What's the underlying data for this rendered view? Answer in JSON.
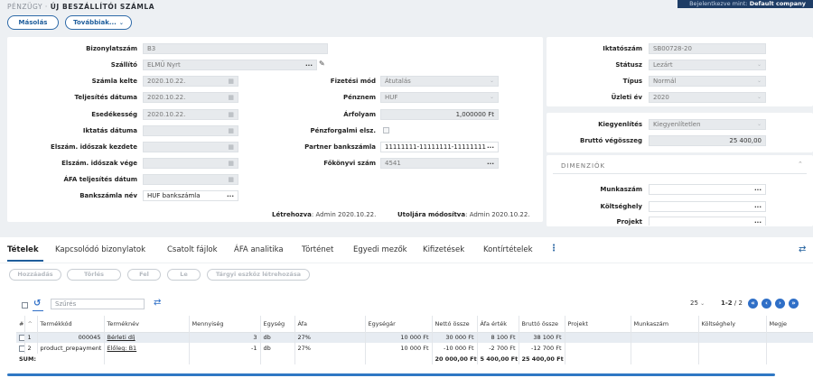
{
  "breadcrumb": {
    "section": "PÉNZÜGY",
    "separator": "·",
    "title": "ÚJ BESZÁLLÍTÓI SZÁMLA"
  },
  "login": {
    "prefix": "Bejelentkezve mint:",
    "company": "Default company"
  },
  "toolbar": {
    "copy_label": "Másolás",
    "more_label": "Továbbiak..."
  },
  "form": {
    "bizonylatszam": {
      "label": "Bizonylatszám",
      "value": "B3"
    },
    "szallito": {
      "label": "Szállító",
      "value": "ELMŰ Nyrt"
    },
    "szamla_kelte": {
      "label": "Számla kelte",
      "value": "2020.10.22."
    },
    "teljesites": {
      "label": "Teljesítés dátuma",
      "value": "2020.10.22."
    },
    "esedekesseg": {
      "label": "Esedékesség",
      "value": "2020.10.22."
    },
    "iktatas": {
      "label": "Iktatás dátuma",
      "value": ""
    },
    "elsz_kezdete": {
      "label": "Elszám. időszak kezdete",
      "value": ""
    },
    "elsz_vege": {
      "label": "Elszám. időszak vége",
      "value": ""
    },
    "afa_telj": {
      "label": "ÁFA teljesítés dátum",
      "value": ""
    },
    "bankszamla_nev": {
      "label": "Bankszámla név",
      "value": "HUF bankszámla"
    },
    "fizetesi_mod": {
      "label": "Fizetési mód",
      "value": "Átutalás"
    },
    "penznem": {
      "label": "Pénznem",
      "value": "HUF"
    },
    "arfolyam": {
      "label": "Árfolyam",
      "value": "1,000000 Ft"
    },
    "penzforgalmi": {
      "label": "Pénzforgalmi elsz."
    },
    "partner_bank": {
      "label": "Partner bankszámla",
      "value": "11111111-11111111-11111111"
    },
    "fokonyvi": {
      "label": "Főkönyvi szám",
      "value": "4541"
    },
    "created_label": "Létrehozva",
    "created_value": ": Admin 2020.10.22.",
    "modified_label": "Utoljára módosítva",
    "modified_value": ": Admin 2020.10.22."
  },
  "side": {
    "iktatoszam": {
      "label": "Iktatószám",
      "value": "SB00728-20"
    },
    "statusz": {
      "label": "Státusz",
      "value": "Lezárt"
    },
    "tipus": {
      "label": "Típus",
      "value": "Normál"
    },
    "uzleti_ev": {
      "label": "Üzleti év",
      "value": "2020"
    },
    "kiegyenlites": {
      "label": "Kiegyenlítés",
      "value": "Kiegyenlítetlen"
    },
    "brutto": {
      "label": "Bruttó végösszeg",
      "value": "25 400,00"
    },
    "dimensions_title": "DIMENZIÓK",
    "munkaszam": {
      "label": "Munkaszám"
    },
    "koltseghely": {
      "label": "Költséghely"
    },
    "projekt": {
      "label": "Projekt"
    }
  },
  "tabs": [
    "Tételek",
    "Kapcsolódó bizonylatok",
    "Csatolt fájlok",
    "ÁFA analitika",
    "Történet",
    "Egyedi mezők",
    "Kifizetések",
    "Kontírtételek"
  ],
  "actions": [
    "Hozzáadás",
    "Törlés",
    "Fel",
    "Le",
    "Tárgyi eszköz létrehozása"
  ],
  "filter": {
    "placeholder": "Szűrés"
  },
  "pager": {
    "page_size": "25",
    "range": "1-2",
    "total": "/ 2"
  },
  "table": {
    "headers": [
      "#",
      "Termékkód",
      "Terméknév",
      "Mennyiség",
      "Egység",
      "Áfa",
      "Egységár",
      "Nettó össze",
      "Áfa érték",
      "Bruttó össze",
      "Projekt",
      "Munkaszám",
      "Költséghely",
      "Megje"
    ],
    "rows": [
      {
        "n": "1",
        "kod": "000045",
        "nev": "Bérleti díj",
        "menny": "3",
        "egys": "db",
        "afa": "27%",
        "ar": "10 000 Ft",
        "netto": "30 000 Ft",
        "afaert": "8 100 Ft",
        "brutto": "38 100 Ft"
      },
      {
        "n": "2",
        "kod": "product_prepayment",
        "nev": "Előleg: B1",
        "menny": "-1",
        "egys": "db",
        "afa": "27%",
        "ar": "10 000 Ft",
        "netto": "-10 000 Ft",
        "afaert": "-2 700 Ft",
        "brutto": "-12 700 Ft"
      }
    ],
    "sum": {
      "label": "SUM:",
      "netto": "20 000,00 Ft",
      "afaert": "5 400,00 Ft",
      "brutto": "25 400,00 Ft"
    }
  }
}
